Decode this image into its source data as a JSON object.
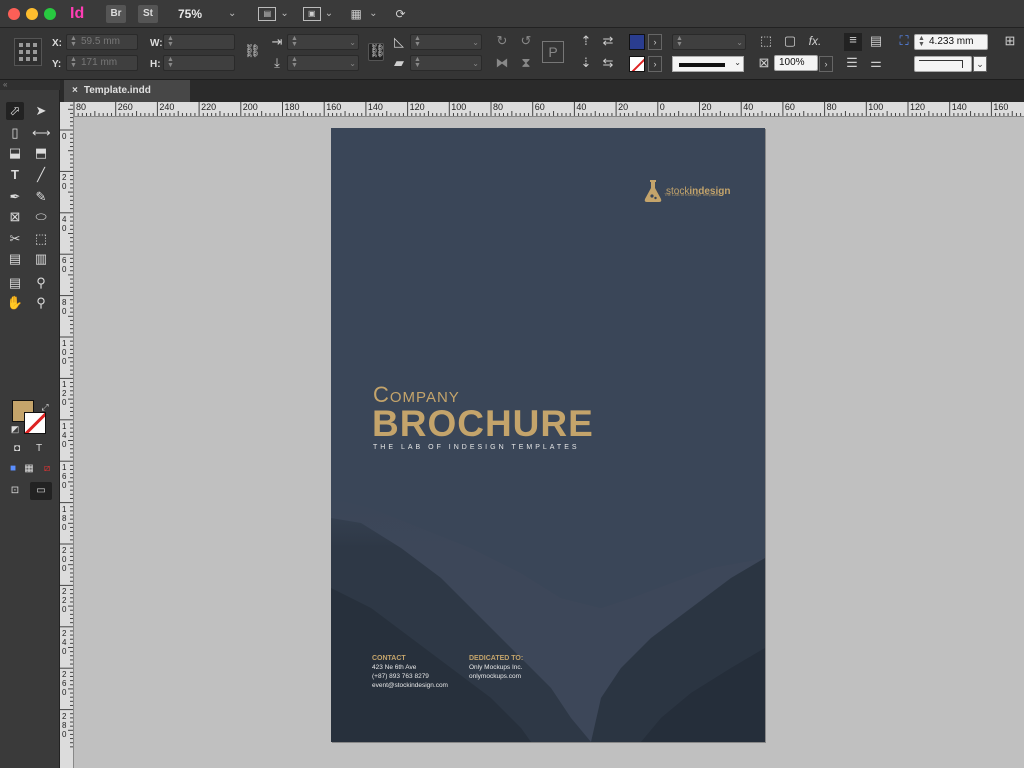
{
  "app": {
    "logo": "Id",
    "bridge_label": "Br",
    "stock_label": "St",
    "zoom": "75%"
  },
  "control": {
    "x_label": "X:",
    "y_label": "Y:",
    "w_label": "W:",
    "h_label": "H:",
    "x_value": "59.5 mm",
    "y_value": "171 mm",
    "zoom_percent": "100%",
    "dimension_value": "4.233 mm"
  },
  "document_tab": {
    "close": "×",
    "title": "Template.indd"
  },
  "rulers": {
    "horizontal": [
      "80",
      "260",
      "240",
      "220",
      "200",
      "180",
      "160",
      "140",
      "120",
      "100",
      "80",
      "60",
      "40",
      "20",
      "0",
      "20",
      "40",
      "60",
      "80",
      "100",
      "120",
      "140",
      "160"
    ],
    "vertical": [
      "0",
      "2 0",
      "4 0",
      "6 0",
      "8 0",
      "1 0 0",
      "1 2 0",
      "1 4 0",
      "1 6 0",
      "1 8 0",
      "2 0 0",
      "2 2 0",
      "2 4 0",
      "2 6 0",
      "2 8 0"
    ]
  },
  "page": {
    "brand_prefix": "stock",
    "brand_suffix": "indesign",
    "brand_tagline": "The LAB of InDesign Templates",
    "company": "Company",
    "brochure": "BROCHURE",
    "tagline": "THE LAB OF INDESIGN TEMPLATES",
    "contact": {
      "heading": "CONTACT",
      "address": "423 Ne 6th Ave",
      "phone": "(+87) 893 763 8279",
      "email": "event@stockindesign.com"
    },
    "dedicated": {
      "heading": "DEDICATED TO:",
      "line1": "Only Mockups Inc.",
      "line2": "onlymockups.com"
    }
  },
  "colors": {
    "page_bg": "#3a4658",
    "accent_gold": "#c4a46b",
    "fill_swatch": "#c4a46b",
    "stroke_blue": "#2a3d8f"
  }
}
